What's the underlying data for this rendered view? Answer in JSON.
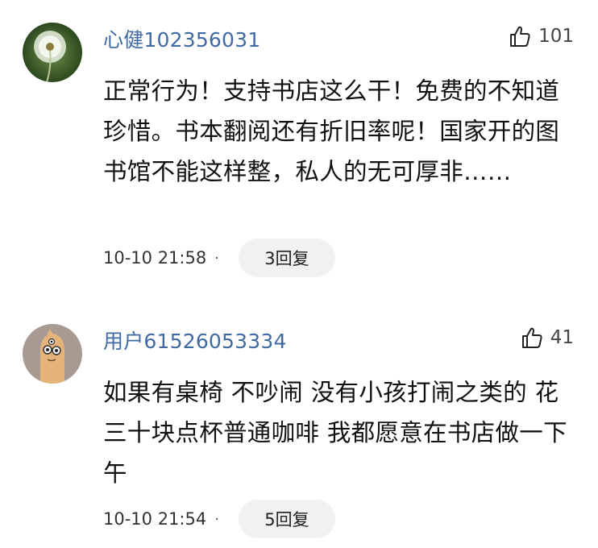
{
  "comments": [
    {
      "username": "心健102356031",
      "likes": "101",
      "text": "正常行为！支持书店这么干！免费的不知道珍惜。书本翻阅还有折旧率呢！国家开的图书馆不能这样整，私人的无可厚非……",
      "timestamp": "10-10 21:58",
      "separator": "·",
      "reply_label": "3回复",
      "avatar": "dandelion-avatar"
    },
    {
      "username": "用户61526053334",
      "likes": "41",
      "text": "如果有桌椅 不吵闹 没有小孩打闹之类的 花三十块点杯普通咖啡 我都愿意在书店做一下午",
      "timestamp": "10-10 21:54",
      "separator": "·",
      "reply_label": "5回复",
      "avatar": "cartoon-avatar"
    }
  ],
  "colors": {
    "username": "#3f6aa3",
    "text": "#111111",
    "reply_bg": "#f0f1f3"
  },
  "icons": {
    "like": "thumbs-up-icon"
  }
}
